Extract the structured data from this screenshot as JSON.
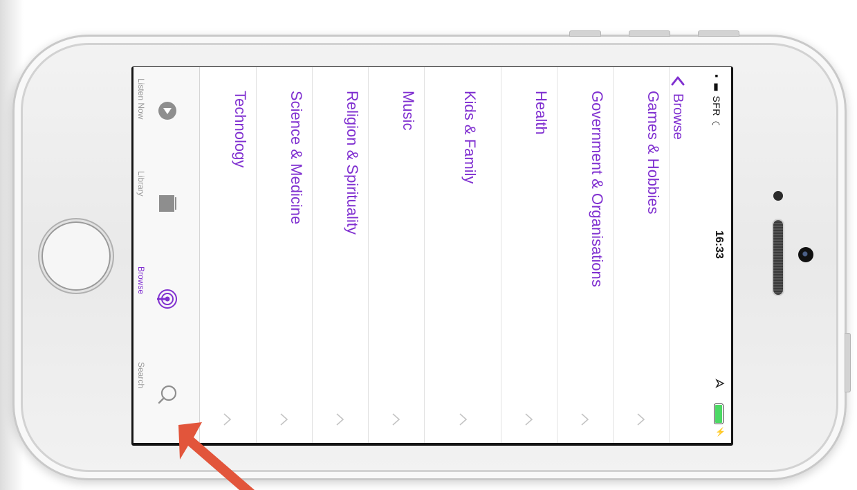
{
  "status_bar": {
    "carrier": "SFR",
    "time": "16:33",
    "battery_color": "#4cd964"
  },
  "nav": {
    "back_label": "Browse",
    "accent_color": "#8030d0"
  },
  "categories": [
    {
      "label": "Games & Hobbies"
    },
    {
      "label": "Government & Organisations"
    },
    {
      "label": "Health"
    },
    {
      "label": "Kids & Family"
    },
    {
      "label": "Music"
    },
    {
      "label": "Religion & Spirituality"
    },
    {
      "label": "Science & Medicine"
    },
    {
      "label": "Technology"
    }
  ],
  "tabbar": {
    "tabs": [
      {
        "label": "Listen Now",
        "icon": "play-circle-icon",
        "active": false
      },
      {
        "label": "Library",
        "icon": "library-icon",
        "active": false
      },
      {
        "label": "Browse",
        "icon": "podcast-icon",
        "active": true
      },
      {
        "label": "Search",
        "icon": "search-icon",
        "active": false
      }
    ]
  },
  "annotation": {
    "arrow_color": "#e2553b"
  }
}
